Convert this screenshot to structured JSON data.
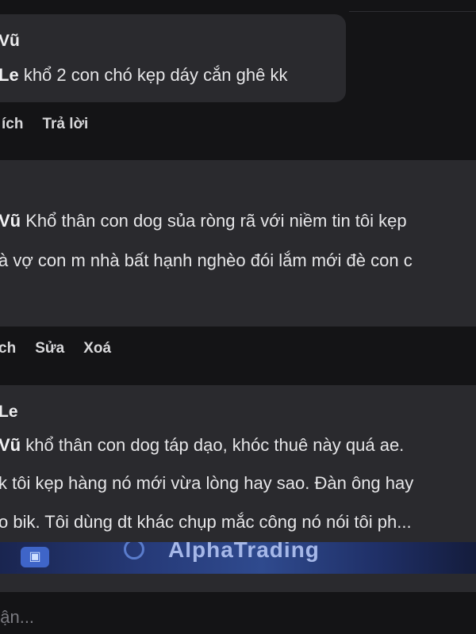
{
  "comments": [
    {
      "author": "Vũ",
      "mention": "Le",
      "lines": [
        "khổ 2 con chó kẹp dáy cắn ghê kk"
      ],
      "actions": [
        "ích",
        "Trả lời"
      ]
    },
    {
      "author": "",
      "mention": "Vũ",
      "lines": [
        "Khổ thân con dog sủa ròng rã với niềm tin tôi kẹp",
        "à vợ con m nhà bất hạnh nghèo đói lắm mới đè con c"
      ],
      "actions": [
        "ch",
        "Sửa",
        "Xoá"
      ]
    },
    {
      "author": "Le",
      "mention": "Vũ",
      "lines": [
        "khổ thân con dog táp dạo, khóc thuê này quá ae.",
        "k tôi kẹp hàng nó mới vừa lòng hay sao. Đàn ông hay",
        "o bik. Tôi dùng dt khác chụp mắc công nó nói tôi ph..."
      ],
      "attachment_text": "AlphaTrading"
    }
  ],
  "composer": {
    "placeholder": "uận..."
  }
}
